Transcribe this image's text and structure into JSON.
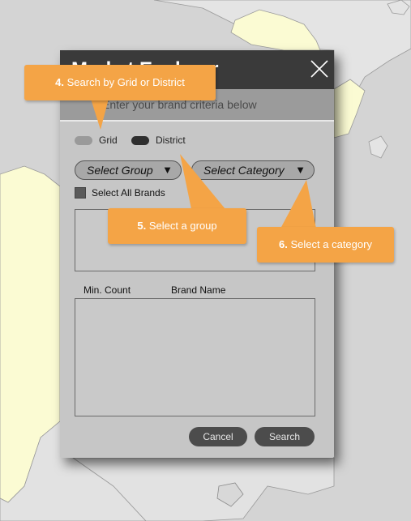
{
  "dialog": {
    "title": "Market Explorer",
    "subtitle": "Enter your brand criteria below",
    "radios": {
      "grid_label": "Grid",
      "district_label": "District"
    },
    "select_group": {
      "label": "Select Group",
      "caret": "▼"
    },
    "select_category": {
      "label": "Select Category",
      "caret": "▼"
    },
    "select_all_label": "Select All Brands",
    "columns": {
      "min_count": "Min. Count",
      "brand_name": "Brand Name"
    },
    "buttons": {
      "cancel": "Cancel",
      "search": "Search"
    }
  },
  "callouts": [
    {
      "number": "4.",
      "text": "Search by Grid or District"
    },
    {
      "number": "5.",
      "text": "Select a group"
    },
    {
      "number": "6.",
      "text": "Select a category"
    }
  ],
  "icons": {
    "close": "close-icon"
  },
  "colors": {
    "callout": "#f4a446",
    "titlebar": "#3a3a3a",
    "dialog": "#c6c6c6",
    "map_land_highlight": "#fbfbd3",
    "map_land": "#e2e2e2",
    "map_sea": "#d4d4d4"
  }
}
